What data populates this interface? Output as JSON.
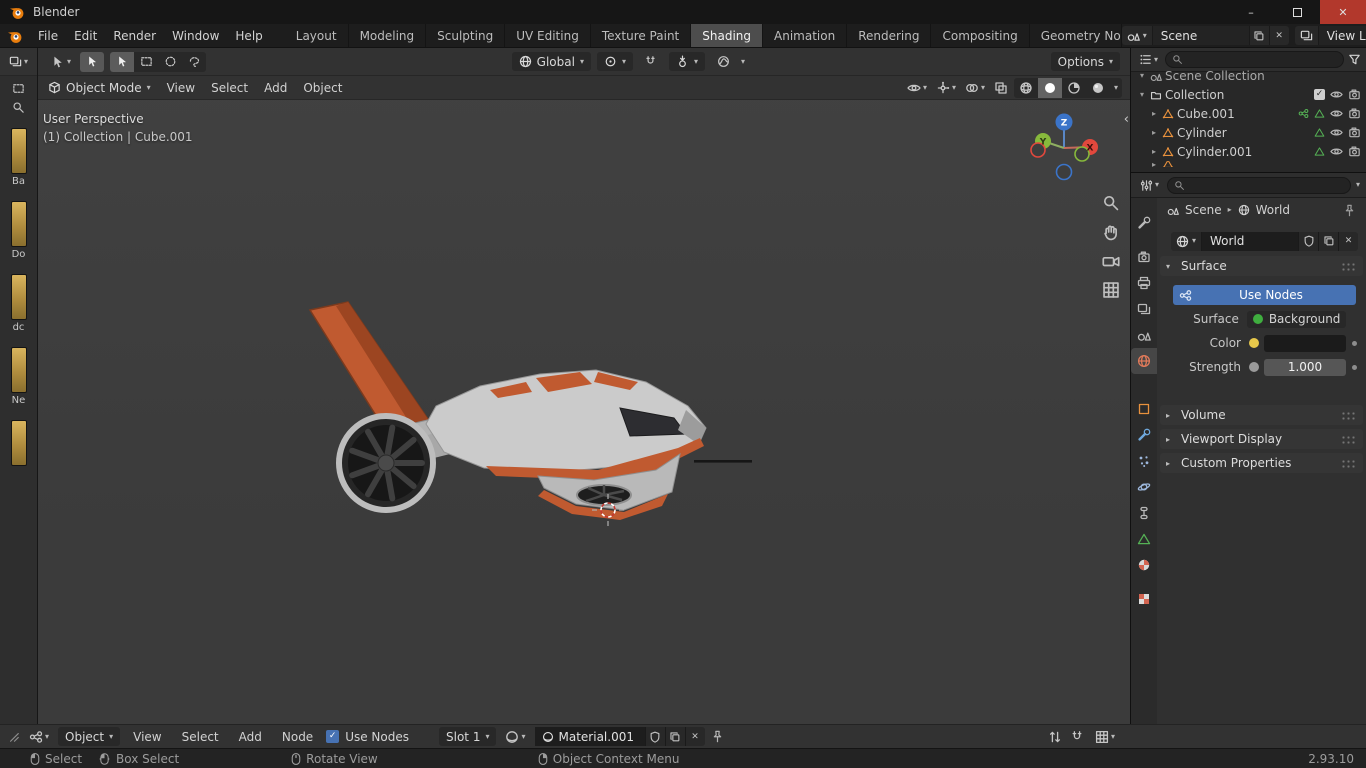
{
  "icons": {
    "chevron_down": "▾",
    "chevron_right": "▸",
    "close": "✕",
    "check": "✓",
    "collapse_left": "‹",
    "minimize": "–"
  },
  "titlebar": {
    "title": "Blender"
  },
  "menubar": {
    "menus": [
      "File",
      "Edit",
      "Render",
      "Window",
      "Help"
    ],
    "workspaces": [
      "Layout",
      "Modeling",
      "Sculpting",
      "UV Editing",
      "Texture Paint",
      "Shading",
      "Animation",
      "Rendering",
      "Compositing",
      "Geometry Nod"
    ],
    "scene": "Scene",
    "view_layer": "View Layer"
  },
  "tool_header": {
    "orientation": "Global",
    "options": "Options"
  },
  "file_strip": {
    "labels": [
      "Ba",
      "Do",
      "dc",
      "Ne"
    ]
  },
  "viewport": {
    "mode": "Object Mode",
    "menus": [
      "View",
      "Select",
      "Add",
      "Object"
    ],
    "perspective": "User Perspective",
    "context": "(1) Collection | Cube.001",
    "axis_x": "X",
    "axis_y": "Y",
    "axis_z": "Z"
  },
  "outliner": {
    "root": "Scene Collection",
    "rows": [
      "Collection",
      "Cube.001",
      "Cylinder",
      "Cylinder.001"
    ]
  },
  "properties": {
    "breadcrumb_scene": "Scene",
    "breadcrumb_world": "World",
    "world_name": "World",
    "surface_panel": "Surface",
    "use_nodes": "Use Nodes",
    "surface_label": "Surface",
    "surface_value": "Background",
    "color_label": "Color",
    "strength_label": "Strength",
    "strength_value": "1.000",
    "volume_panel": "Volume",
    "viewport_display_panel": "Viewport Display",
    "custom_properties_panel": "Custom Properties"
  },
  "shader_editor": {
    "type": "Object",
    "menus": [
      "View",
      "Select",
      "Add",
      "Node"
    ],
    "use_nodes": "Use Nodes",
    "slot": "Slot 1",
    "material": "Material.001"
  },
  "statusbar": {
    "select": "Select",
    "box_select": "Box Select",
    "rotate_view": "Rotate View",
    "context_menu": "Object Context Menu",
    "version": "2.93.10"
  },
  "colors": {
    "accent": "#4772b3",
    "blender_orange": "#e87d0d",
    "model_orange": "#c05a30",
    "socket_color": "#e7c84b",
    "socket_shader": "#3fae3f",
    "socket_value": "#9a9a9a",
    "world_color_value": "#1b1b1b"
  }
}
